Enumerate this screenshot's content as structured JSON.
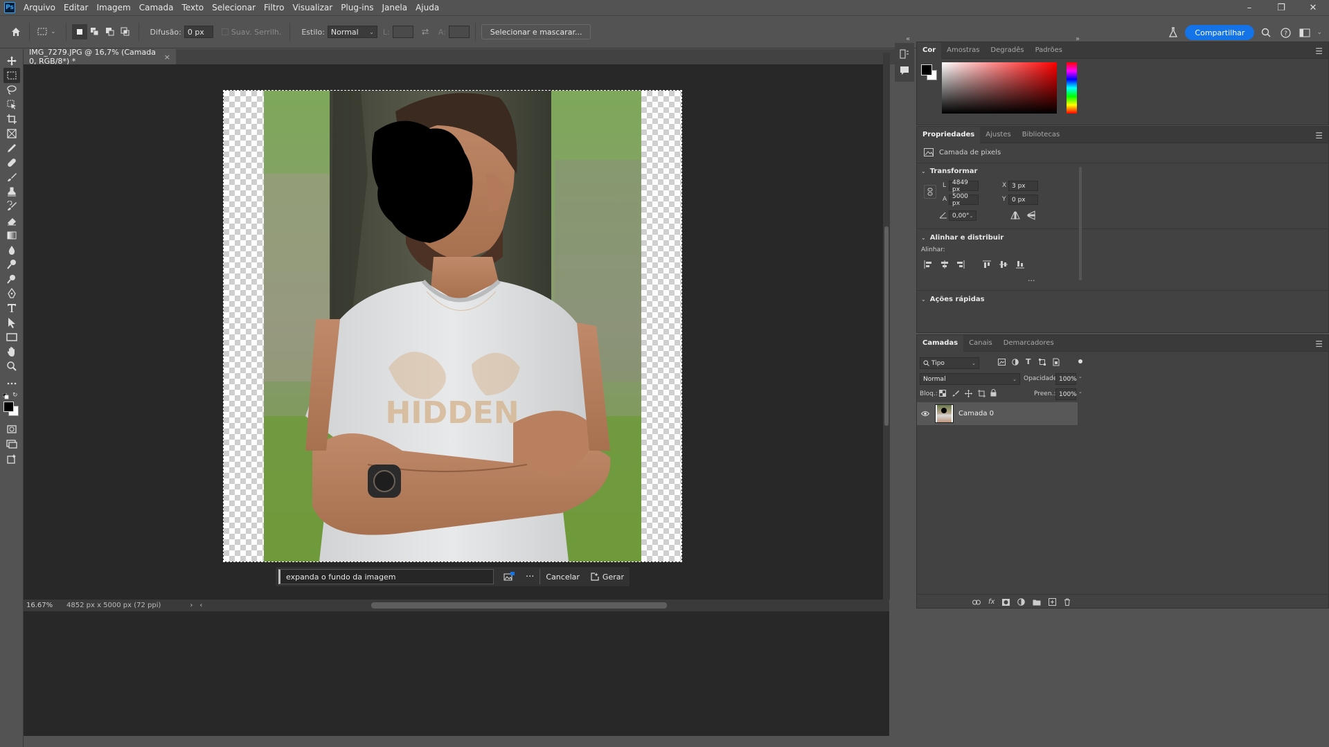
{
  "app": {
    "logo": "Ps"
  },
  "menu": [
    "Arquivo",
    "Editar",
    "Imagem",
    "Camada",
    "Texto",
    "Selecionar",
    "Filtro",
    "Visualizar",
    "Plug-ins",
    "Janela",
    "Ajuda"
  ],
  "window_controls": {
    "minimize": "–",
    "restore": "❐",
    "close": "✕"
  },
  "options": {
    "feather_label": "Difusão:",
    "feather_value": "0 px",
    "antialias_label": "Suav. Serrilh.",
    "style_label": "Estilo:",
    "style_value": "Normal",
    "width_label": "L:",
    "height_label": "A:",
    "select_mask_button": "Selecionar e mascarar...",
    "share_button": "Compartilhar"
  },
  "document": {
    "tab_title": "IMG_7279.JPG @ 16,7% (Camada 0, RGB/8*) *",
    "close": "×"
  },
  "taskbar": {
    "prompt_value": "expanda o fundo da imagem",
    "more": "···",
    "cancel": "Cancelar",
    "generate": "Gerar"
  },
  "status": {
    "zoom": "16.67%",
    "doc_size": "4852 px x 5000 px (72 ppi)"
  },
  "color_panel": {
    "tabs": [
      "Cor",
      "Amostras",
      "Degradês",
      "Padrões"
    ],
    "active_tab": 0
  },
  "properties_panel": {
    "tabs": [
      "Propriedades",
      "Ajustes",
      "Bibliotecas"
    ],
    "layer_type": "Camada de pixels",
    "transform": {
      "title": "Transformar",
      "w_label": "L",
      "w_value": "4849 px",
      "h_label": "A",
      "h_value": "5000 px",
      "x_label": "X",
      "x_value": "3 px",
      "y_label": "Y",
      "y_value": "0 px",
      "angle_value": "0,00°"
    },
    "align": {
      "title": "Alinhar e distribuir",
      "align_label": "Alinhar:",
      "more": "···"
    },
    "quick_actions": {
      "title": "Ações rápidas"
    }
  },
  "layers_panel": {
    "tabs": [
      "Camadas",
      "Canais",
      "Demarcadores"
    ],
    "filter_kind": "Tipo",
    "blend_mode": "Normal",
    "opacity_label": "Opacidade:",
    "opacity_value": "100%",
    "lock_label": "Bloq.:",
    "fill_label": "Preen.:",
    "fill_value": "100%",
    "layers": [
      {
        "name": "Camada 0",
        "visible": true
      }
    ]
  },
  "colors": {
    "accent": "#1473e6",
    "ui_bg": "#535353",
    "canvas_bg": "#282828",
    "panel_bg": "#424242"
  }
}
